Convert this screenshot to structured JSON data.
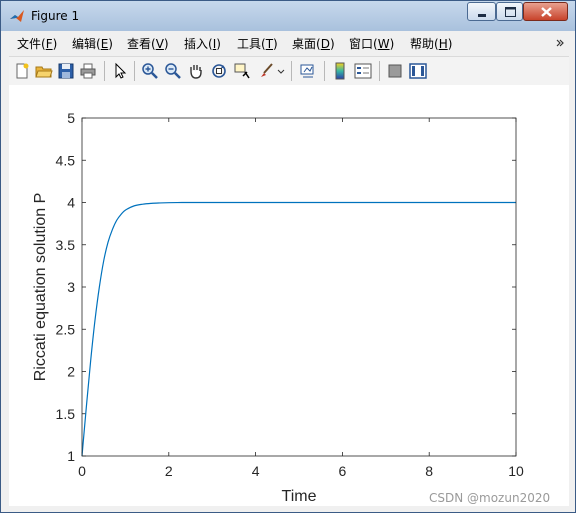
{
  "window": {
    "title": "Figure 1"
  },
  "menu": [
    {
      "label": "文件(",
      "key": "F",
      "suffix": ")"
    },
    {
      "label": "编辑(",
      "key": "E",
      "suffix": ")"
    },
    {
      "label": "查看(",
      "key": "V",
      "suffix": ")"
    },
    {
      "label": "插入(",
      "key": "I",
      "suffix": ")"
    },
    {
      "label": "工具(",
      "key": "T",
      "suffix": ")"
    },
    {
      "label": "桌面(",
      "key": "D",
      "suffix": ")"
    },
    {
      "label": "窗口(",
      "key": "W",
      "suffix": ")"
    },
    {
      "label": "帮助(",
      "key": "H",
      "suffix": ")"
    }
  ],
  "menu_overflow_icon": "double-chevron-icon",
  "toolbar": [
    "new-figure-icon",
    "open-file-icon",
    "save-icon",
    "print-icon",
    "edit-plot-arrow-icon",
    "zoom-in-icon",
    "zoom-out-icon",
    "pan-hand-icon",
    "rotate-3d-icon",
    "data-cursor-icon",
    "brush-icon",
    "link-plot-icon",
    "colorbar-icon",
    "legend-icon",
    "hide-plot-tools-icon",
    "show-plot-tools-icon"
  ],
  "chart_data": {
    "type": "line",
    "title": "",
    "xlabel": "Time",
    "ylabel": "Riccati equation solution P",
    "xlim": [
      0,
      10
    ],
    "ylim": [
      1,
      5
    ],
    "xticks": [
      "0",
      "2",
      "4",
      "6",
      "8",
      "10"
    ],
    "yticks": [
      "1",
      "1.5",
      "2",
      "2.5",
      "3",
      "3.5",
      "4",
      "4.5",
      "5"
    ],
    "grid": false,
    "line_color": "#0072bd",
    "series": [
      {
        "x": [
          0,
          0.1,
          0.2,
          0.3,
          0.4,
          0.5,
          0.6,
          0.7,
          0.8,
          0.9,
          1.0,
          1.2,
          1.4,
          1.6,
          1.8,
          2.0,
          2.3,
          2.6,
          3.0,
          3.5,
          4.0,
          5.0,
          6.0,
          7.0,
          8.0,
          9.0,
          10.0
        ],
        "values": [
          1.0,
          1.58,
          2.13,
          2.61,
          3.0,
          3.31,
          3.53,
          3.68,
          3.79,
          3.86,
          3.91,
          3.96,
          3.98,
          3.99,
          3.995,
          3.998,
          4.0,
          4.0,
          4.0,
          4.0,
          4.0,
          4.0,
          4.0,
          4.0,
          4.0,
          4.0,
          4.0
        ]
      }
    ]
  },
  "watermark": "CSDN @mozun2020"
}
